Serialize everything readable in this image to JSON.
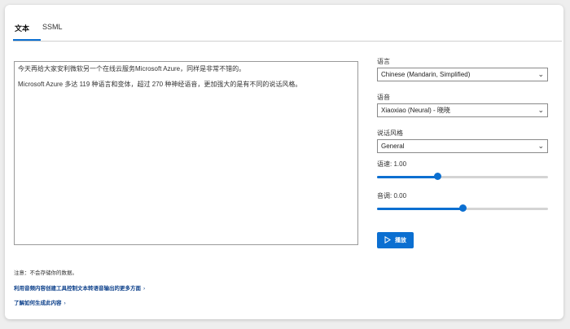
{
  "tabs": [
    {
      "label": "文本",
      "active": true
    },
    {
      "label": "SSML",
      "active": false
    }
  ],
  "editor": {
    "paragraphs": [
      "今天再给大家安利微软另一个在线云服务Microsoft Azure，同样是非常不错的。",
      "Microsoft Azure 多达 119 种语言和变体，超过 270 种神经语音，更加强大的是有不同的说话风格。"
    ]
  },
  "language": {
    "label": "语言",
    "value": "Chinese (Mandarin, Simplified)"
  },
  "voice": {
    "label": "语音",
    "value": "Xiaoxiao (Neural) - 晓晓"
  },
  "style": {
    "label": "说话风格",
    "value": "General"
  },
  "speed": {
    "label": "语速: 1.00",
    "level": 0.35
  },
  "pitch": {
    "label": "音调: 0.00",
    "level": 0.5
  },
  "play_button": {
    "label": "播放"
  },
  "note": "注意：不会存储你的数据。",
  "links": [
    "利用音频内容创建工具控制文本转语音输出的更多方面",
    "了解如何生成此内容"
  ],
  "colors": {
    "accent": "#0b6fd1",
    "link": "#0b3f8a"
  }
}
